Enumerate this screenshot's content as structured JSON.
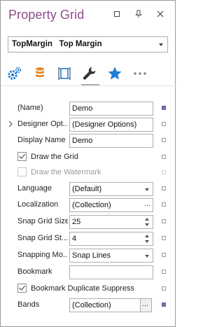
{
  "window": {
    "title": "Property Grid",
    "title_color": "#8e4a8a"
  },
  "selector": {
    "object_name": "TopMargin",
    "object_type": "Top Margin"
  },
  "tabs": [
    {
      "icon": "gear-icon",
      "color": "#1e7ed6"
    },
    {
      "icon": "database-icon",
      "color": "#e8892a"
    },
    {
      "icon": "layout-icon",
      "color": "#1e7ed6"
    },
    {
      "icon": "wrench-icon",
      "color": "#333333",
      "active": true
    },
    {
      "icon": "star-icon",
      "color": "#1e7ed6"
    },
    {
      "icon": "more-icon",
      "color": "#888888"
    }
  ],
  "properties": {
    "name": {
      "label": "(Name)",
      "value": "Demo"
    },
    "designer_options": {
      "label": "Designer Opt...",
      "value": "(Designer Options)"
    },
    "display_name": {
      "label": "Display Name",
      "value": "Demo"
    },
    "draw_grid": {
      "label": "Draw the Grid",
      "checked": true
    },
    "draw_watermark": {
      "label": "Draw the Watermark",
      "checked": false
    },
    "language": {
      "label": "Language",
      "value": "(Default)"
    },
    "localization": {
      "label": "Localization",
      "value": "(Collection)",
      "button": "..."
    },
    "snap_grid_size": {
      "label": "Snap Grid Size",
      "value": "25"
    },
    "snap_grid_step": {
      "label": "Snap Grid St...",
      "value": "4"
    },
    "snapping_mode": {
      "label": "Snapping Mo...",
      "value": "Snap Lines"
    },
    "bookmark": {
      "label": "Bookmark",
      "value": ""
    },
    "bookmark_dup": {
      "label": "Bookmark Duplicate Suppress",
      "checked": true
    },
    "bands": {
      "label": "Bands",
      "value": "(Collection)",
      "button": "..."
    }
  }
}
